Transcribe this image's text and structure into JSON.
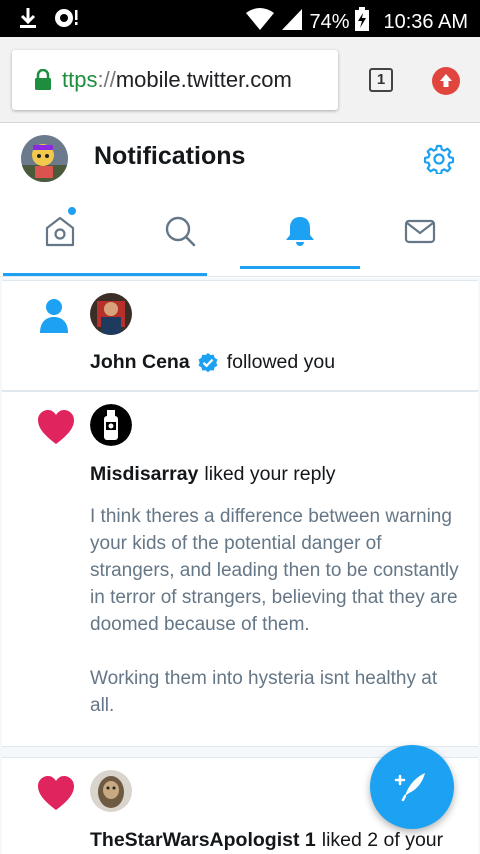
{
  "status_bar": {
    "battery": "74%",
    "time": "10:36 AM",
    "icons": [
      "download-icon",
      "cloud-sync-icon",
      "wifi-icon",
      "signal-icon",
      "battery-charging-icon"
    ]
  },
  "browser": {
    "url_scheme": "ttps",
    "url_sep": "://",
    "url_host": "mobile.twitter.com",
    "tab_count": "1",
    "icons": [
      "lock-icon",
      "update-icon"
    ]
  },
  "header": {
    "title": "Notifications",
    "icons": [
      "avatar",
      "gear-icon"
    ]
  },
  "tabs": [
    {
      "name": "home",
      "icon": "home-icon",
      "active": false,
      "has_dot": true
    },
    {
      "name": "search",
      "icon": "search-icon",
      "active": false
    },
    {
      "name": "notifications",
      "icon": "bell-icon",
      "active": true
    },
    {
      "name": "messages",
      "icon": "mail-icon",
      "active": false
    }
  ],
  "notifications": [
    {
      "type": "follow",
      "icon": "person-icon",
      "user": "John Cena",
      "verified": true,
      "action": "followed you"
    },
    {
      "type": "like",
      "icon": "heart-icon",
      "user": "Misdisarray",
      "action": "liked your reply",
      "body": [
        "I think theres a difference between warning your kids of the potential danger of strangers, and leading then to be constantly in terror of strangers, believing that they are doomed because of them.",
        "Working them into hysteria isnt healthy at all."
      ]
    },
    {
      "type": "like",
      "icon": "heart-icon",
      "user": "TheStarWarsApologist 1",
      "action": "liked 2 of your"
    }
  ],
  "fab": {
    "icon": "compose-icon"
  },
  "colors": {
    "accent": "#1da1f2",
    "like": "#e0245e",
    "text_primary": "#14171a",
    "text_secondary": "#657786",
    "secure_green": "#1e8e3e"
  }
}
